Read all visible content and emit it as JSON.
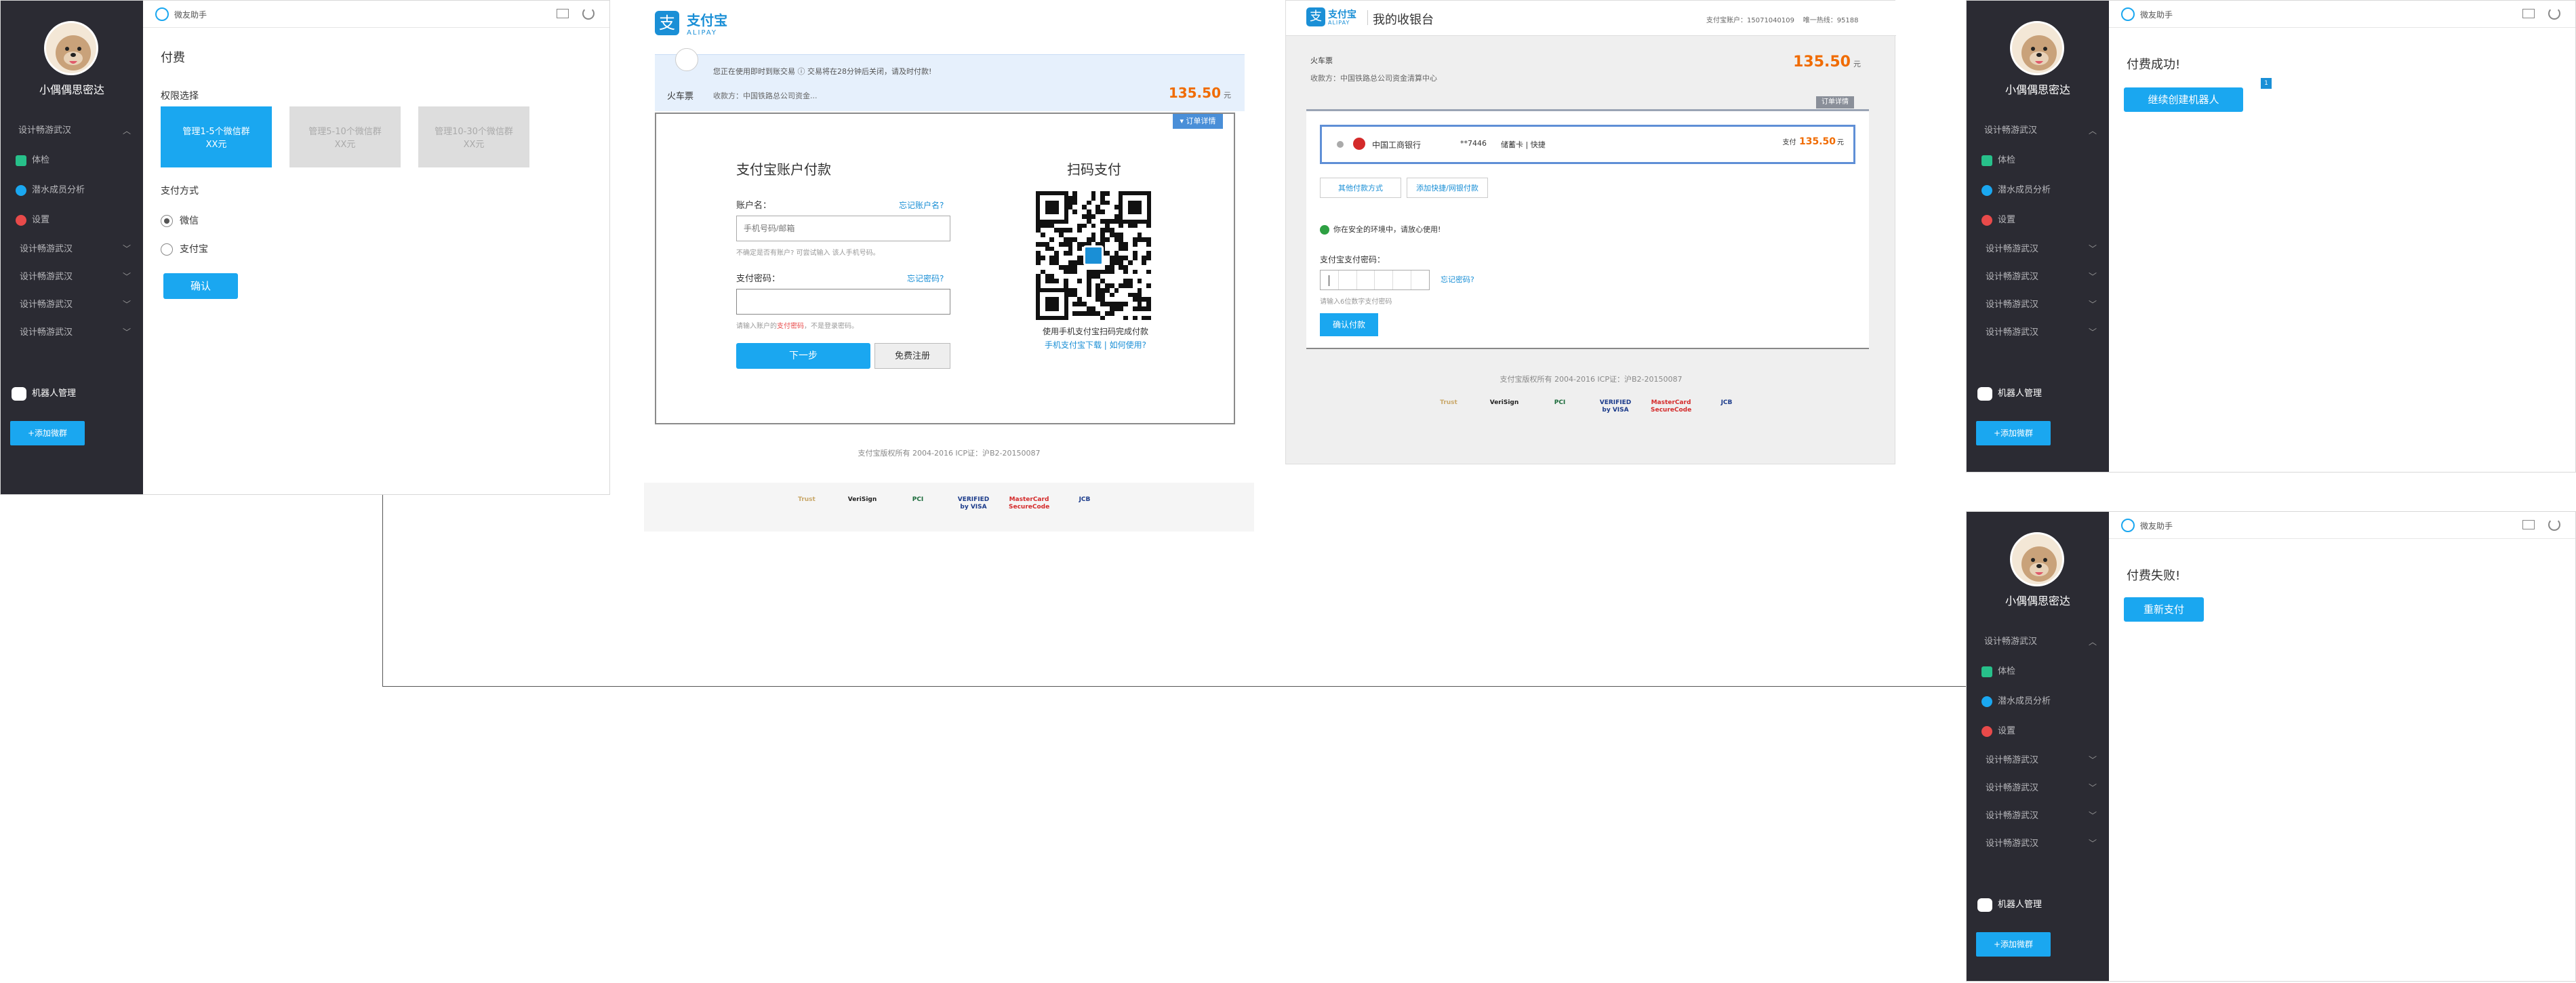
{
  "app_common": {
    "username": "小偶偶思密达",
    "topbar_title": "微友助手",
    "nav_group_label": "设计畅游武汉",
    "nav_items": [
      "体检",
      "潜水成员分析",
      "设置"
    ],
    "nav_more": [
      "设计畅游武汉",
      "设计畅游武汉",
      "设计畅游武汉",
      "设计畅游武汉"
    ],
    "robot_label": "机器人管理",
    "add_button": "+添加微群"
  },
  "payment_panel": {
    "title": "付费",
    "authority_label": "权限选择",
    "options": [
      "管理1-5个微信群\nXX元",
      "管理5-10个微信群\nXX元",
      "管理10-30个微信群\nXX元"
    ],
    "method_label": "支付方式",
    "methods": [
      "微信",
      "支付宝"
    ],
    "confirm": "确认"
  },
  "alipay_login": {
    "logo_text": "支付宝",
    "logo_sub": "ALIPAY",
    "notice": "您正在使用即时到账交易 ⓘ   交易将在28分钟后关闭，请及时付款!",
    "item": "火车票",
    "payee": "收款方：中国铁路总公司资金...",
    "amount": "135.50",
    "unit": "元",
    "detail_btn": "▾ 订单详情",
    "account_title": "支付宝账户付款",
    "account_label": "账户名：",
    "forgot_account": "忘记账户名?",
    "account_placeholder": "手机号码/邮箱",
    "account_hint": "不确定是否有账户? 可尝试输入 该人手机号码。",
    "pwd_label": "支付密码：",
    "forgot_pwd": "忘记密码?",
    "pwd_hint_pre": "请输入账户的",
    "pwd_hint_link": "支付密码",
    "pwd_hint_post": "，不是登录密码。",
    "next": "下一步",
    "register": "免费注册",
    "scan_title": "扫码支付",
    "scan_hint": "使用手机支付宝扫码完成付款",
    "scan_link1": "手机支付宝下载",
    "scan_sep": "|",
    "scan_link2": "如何使用?",
    "footer": "支付宝版权所有 2004-2016 ICP证：沪B2-20150087"
  },
  "cashier": {
    "title": "我的收银台",
    "account_info": "支付宝账户：15071040109    唯一热线：95188",
    "item": "火车票",
    "payee": "收款方：中国铁路总公司资金清算中心",
    "amount": "135.50",
    "unit": "元",
    "detail_btn": "订单详情",
    "bank": "中国工商银行",
    "card": "**7446",
    "card_type": "储蓄卡 | 快捷",
    "pay_label": "支付",
    "other_method": "其他付款方式",
    "add_card": "添加快捷/网银付款",
    "secure": "你在安全的环境中，请放心使用!",
    "pwd_label": "支付宝支付密码：",
    "forgot": "忘记密码?",
    "pwd_hint": "请输入6位数字支付密码",
    "confirm": "确认付款",
    "footer": "支付宝版权所有 2004-2016 ICP证：沪B2-20150087"
  },
  "trust_logos": [
    "Trust",
    "VeriSign",
    "PCI",
    "VERIFIED by VISA",
    "MasterCard SecureCode",
    "JCB"
  ],
  "success_panel": {
    "message": "付费成功!",
    "button": "继续创建机器人",
    "badge": "1"
  },
  "fail_panel": {
    "message": "付费失败!",
    "button": "重新支付"
  }
}
